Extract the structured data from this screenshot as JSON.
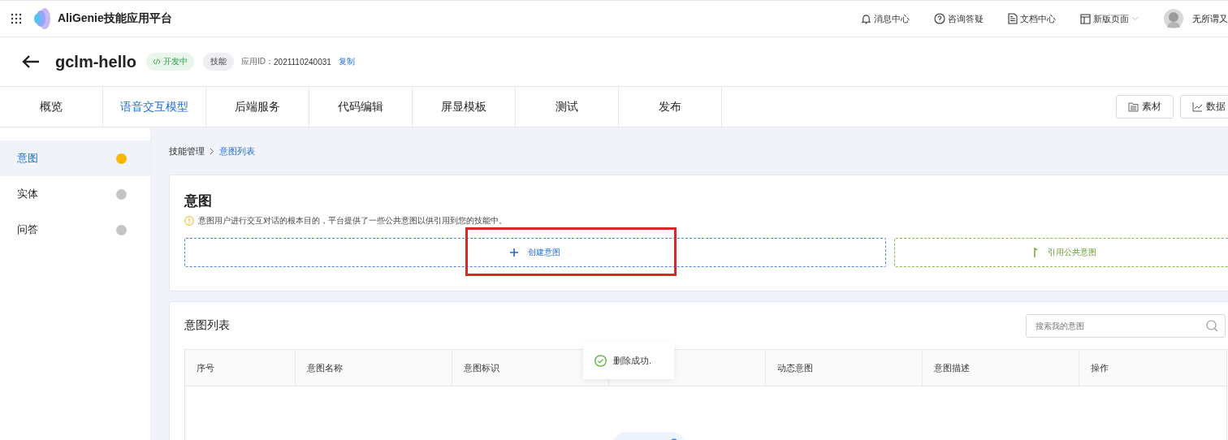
{
  "topbar": {
    "brand": "AliGenie技能应用平台",
    "links": [
      {
        "kind": "bell",
        "label": "消息中心"
      },
      {
        "kind": "help",
        "label": "咨询答疑"
      },
      {
        "kind": "doc",
        "label": "文档中心"
      },
      {
        "kind": "layout",
        "label": "新版页面",
        "dropdown": true
      }
    ],
    "user": "无所谓又"
  },
  "header": {
    "title": "gclm-hello",
    "status": "开发中",
    "tag": "技能",
    "app_id_label": "应用ID：",
    "app_id": "2021110240031",
    "copy": "复制"
  },
  "tabs": [
    {
      "label": "概览",
      "selected": false
    },
    {
      "label": "语音交互模型",
      "selected": true
    },
    {
      "label": "后端服务",
      "selected": false
    },
    {
      "label": "代码编辑",
      "selected": false
    },
    {
      "label": "屏显模板",
      "selected": false
    },
    {
      "label": "测试",
      "selected": false
    },
    {
      "label": "发布",
      "selected": false
    }
  ],
  "tab_buttons": [
    {
      "kind": "material",
      "label": "素材"
    },
    {
      "kind": "chart",
      "label": "数据"
    }
  ],
  "sidebar": {
    "items": [
      {
        "label": "意图",
        "selected": true,
        "color": "#f5b800"
      },
      {
        "label": "实体",
        "selected": false,
        "color": "#c4c4c4"
      },
      {
        "label": "问答",
        "selected": false,
        "color": "#c4c4c4"
      }
    ]
  },
  "breadcrumb": [
    "技能管理",
    "意图列表"
  ],
  "intent_card": {
    "title": "意图",
    "notice": "意图用户进行交互对话的根本目的，平台提供了一些公共意图以供引用到您的技能中。",
    "create": "创建意图",
    "reference": "引用公共意图"
  },
  "list": {
    "title": "意图列表",
    "search": {
      "placeholder": "搜索我的意图"
    },
    "columns": [
      {
        "label": "序号"
      },
      {
        "label": "意图名称"
      },
      {
        "label": "意图标识"
      },
      {},
      {
        "label": "动态意图"
      },
      {
        "label": "意图描述"
      },
      {
        "label": "操作"
      }
    ]
  },
  "toast": {
    "message": "删除成功."
  }
}
